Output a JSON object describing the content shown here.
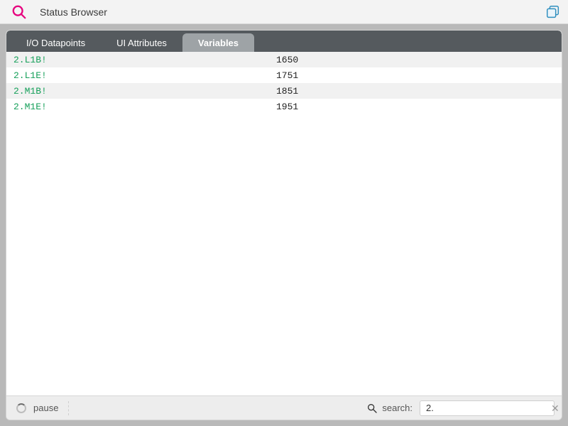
{
  "header": {
    "title": "Status Browser"
  },
  "tabs": [
    {
      "label": "I/O Datapoints",
      "active": false
    },
    {
      "label": "UI Attributes",
      "active": false
    },
    {
      "label": "Variables",
      "active": true
    }
  ],
  "rows": [
    {
      "name": "2.L1B!",
      "value": "1650"
    },
    {
      "name": "2.L1E!",
      "value": "1751"
    },
    {
      "name": "2.M1B!",
      "value": "1851"
    },
    {
      "name": "2.M1E!",
      "value": "1951"
    }
  ],
  "footer": {
    "pause_label": "pause",
    "search_label": "search:",
    "search_value": "2."
  }
}
